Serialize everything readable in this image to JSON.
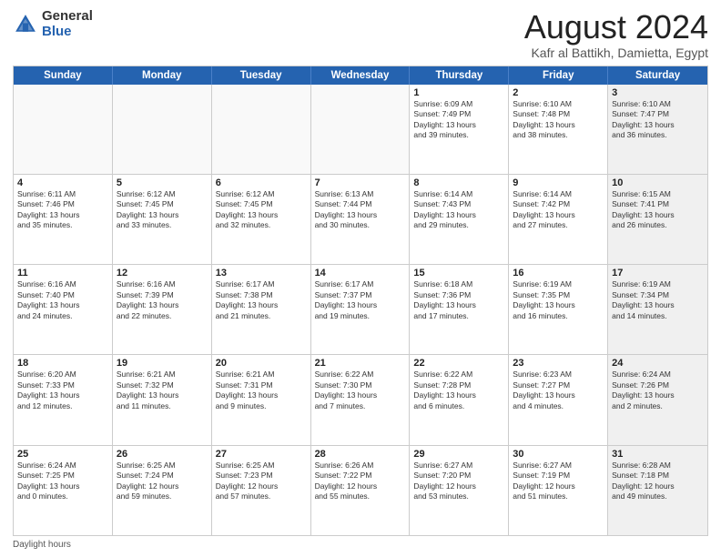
{
  "logo": {
    "general": "General",
    "blue": "Blue"
  },
  "title": "August 2024",
  "location": "Kafr al Battikh, Damietta, Egypt",
  "days_of_week": [
    "Sunday",
    "Monday",
    "Tuesday",
    "Wednesday",
    "Thursday",
    "Friday",
    "Saturday"
  ],
  "weeks": [
    [
      {
        "day": "",
        "info": "",
        "empty": true
      },
      {
        "day": "",
        "info": "",
        "empty": true
      },
      {
        "day": "",
        "info": "",
        "empty": true
      },
      {
        "day": "",
        "info": "",
        "empty": true
      },
      {
        "day": "1",
        "info": "Sunrise: 6:09 AM\nSunset: 7:49 PM\nDaylight: 13 hours\nand 39 minutes.",
        "empty": false
      },
      {
        "day": "2",
        "info": "Sunrise: 6:10 AM\nSunset: 7:48 PM\nDaylight: 13 hours\nand 38 minutes.",
        "empty": false
      },
      {
        "day": "3",
        "info": "Sunrise: 6:10 AM\nSunset: 7:47 PM\nDaylight: 13 hours\nand 36 minutes.",
        "empty": false,
        "shaded": true
      }
    ],
    [
      {
        "day": "4",
        "info": "Sunrise: 6:11 AM\nSunset: 7:46 PM\nDaylight: 13 hours\nand 35 minutes.",
        "empty": false
      },
      {
        "day": "5",
        "info": "Sunrise: 6:12 AM\nSunset: 7:45 PM\nDaylight: 13 hours\nand 33 minutes.",
        "empty": false
      },
      {
        "day": "6",
        "info": "Sunrise: 6:12 AM\nSunset: 7:45 PM\nDaylight: 13 hours\nand 32 minutes.",
        "empty": false
      },
      {
        "day": "7",
        "info": "Sunrise: 6:13 AM\nSunset: 7:44 PM\nDaylight: 13 hours\nand 30 minutes.",
        "empty": false
      },
      {
        "day": "8",
        "info": "Sunrise: 6:14 AM\nSunset: 7:43 PM\nDaylight: 13 hours\nand 29 minutes.",
        "empty": false
      },
      {
        "day": "9",
        "info": "Sunrise: 6:14 AM\nSunset: 7:42 PM\nDaylight: 13 hours\nand 27 minutes.",
        "empty": false
      },
      {
        "day": "10",
        "info": "Sunrise: 6:15 AM\nSunset: 7:41 PM\nDaylight: 13 hours\nand 26 minutes.",
        "empty": false,
        "shaded": true
      }
    ],
    [
      {
        "day": "11",
        "info": "Sunrise: 6:16 AM\nSunset: 7:40 PM\nDaylight: 13 hours\nand 24 minutes.",
        "empty": false
      },
      {
        "day": "12",
        "info": "Sunrise: 6:16 AM\nSunset: 7:39 PM\nDaylight: 13 hours\nand 22 minutes.",
        "empty": false
      },
      {
        "day": "13",
        "info": "Sunrise: 6:17 AM\nSunset: 7:38 PM\nDaylight: 13 hours\nand 21 minutes.",
        "empty": false
      },
      {
        "day": "14",
        "info": "Sunrise: 6:17 AM\nSunset: 7:37 PM\nDaylight: 13 hours\nand 19 minutes.",
        "empty": false
      },
      {
        "day": "15",
        "info": "Sunrise: 6:18 AM\nSunset: 7:36 PM\nDaylight: 13 hours\nand 17 minutes.",
        "empty": false
      },
      {
        "day": "16",
        "info": "Sunrise: 6:19 AM\nSunset: 7:35 PM\nDaylight: 13 hours\nand 16 minutes.",
        "empty": false
      },
      {
        "day": "17",
        "info": "Sunrise: 6:19 AM\nSunset: 7:34 PM\nDaylight: 13 hours\nand 14 minutes.",
        "empty": false,
        "shaded": true
      }
    ],
    [
      {
        "day": "18",
        "info": "Sunrise: 6:20 AM\nSunset: 7:33 PM\nDaylight: 13 hours\nand 12 minutes.",
        "empty": false
      },
      {
        "day": "19",
        "info": "Sunrise: 6:21 AM\nSunset: 7:32 PM\nDaylight: 13 hours\nand 11 minutes.",
        "empty": false
      },
      {
        "day": "20",
        "info": "Sunrise: 6:21 AM\nSunset: 7:31 PM\nDaylight: 13 hours\nand 9 minutes.",
        "empty": false
      },
      {
        "day": "21",
        "info": "Sunrise: 6:22 AM\nSunset: 7:30 PM\nDaylight: 13 hours\nand 7 minutes.",
        "empty": false
      },
      {
        "day": "22",
        "info": "Sunrise: 6:22 AM\nSunset: 7:28 PM\nDaylight: 13 hours\nand 6 minutes.",
        "empty": false
      },
      {
        "day": "23",
        "info": "Sunrise: 6:23 AM\nSunset: 7:27 PM\nDaylight: 13 hours\nand 4 minutes.",
        "empty": false
      },
      {
        "day": "24",
        "info": "Sunrise: 6:24 AM\nSunset: 7:26 PM\nDaylight: 13 hours\nand 2 minutes.",
        "empty": false,
        "shaded": true
      }
    ],
    [
      {
        "day": "25",
        "info": "Sunrise: 6:24 AM\nSunset: 7:25 PM\nDaylight: 13 hours\nand 0 minutes.",
        "empty": false
      },
      {
        "day": "26",
        "info": "Sunrise: 6:25 AM\nSunset: 7:24 PM\nDaylight: 12 hours\nand 59 minutes.",
        "empty": false
      },
      {
        "day": "27",
        "info": "Sunrise: 6:25 AM\nSunset: 7:23 PM\nDaylight: 12 hours\nand 57 minutes.",
        "empty": false
      },
      {
        "day": "28",
        "info": "Sunrise: 6:26 AM\nSunset: 7:22 PM\nDaylight: 12 hours\nand 55 minutes.",
        "empty": false
      },
      {
        "day": "29",
        "info": "Sunrise: 6:27 AM\nSunset: 7:20 PM\nDaylight: 12 hours\nand 53 minutes.",
        "empty": false
      },
      {
        "day": "30",
        "info": "Sunrise: 6:27 AM\nSunset: 7:19 PM\nDaylight: 12 hours\nand 51 minutes.",
        "empty": false
      },
      {
        "day": "31",
        "info": "Sunrise: 6:28 AM\nSunset: 7:18 PM\nDaylight: 12 hours\nand 49 minutes.",
        "empty": false,
        "shaded": true
      }
    ]
  ],
  "footer": "Daylight hours"
}
